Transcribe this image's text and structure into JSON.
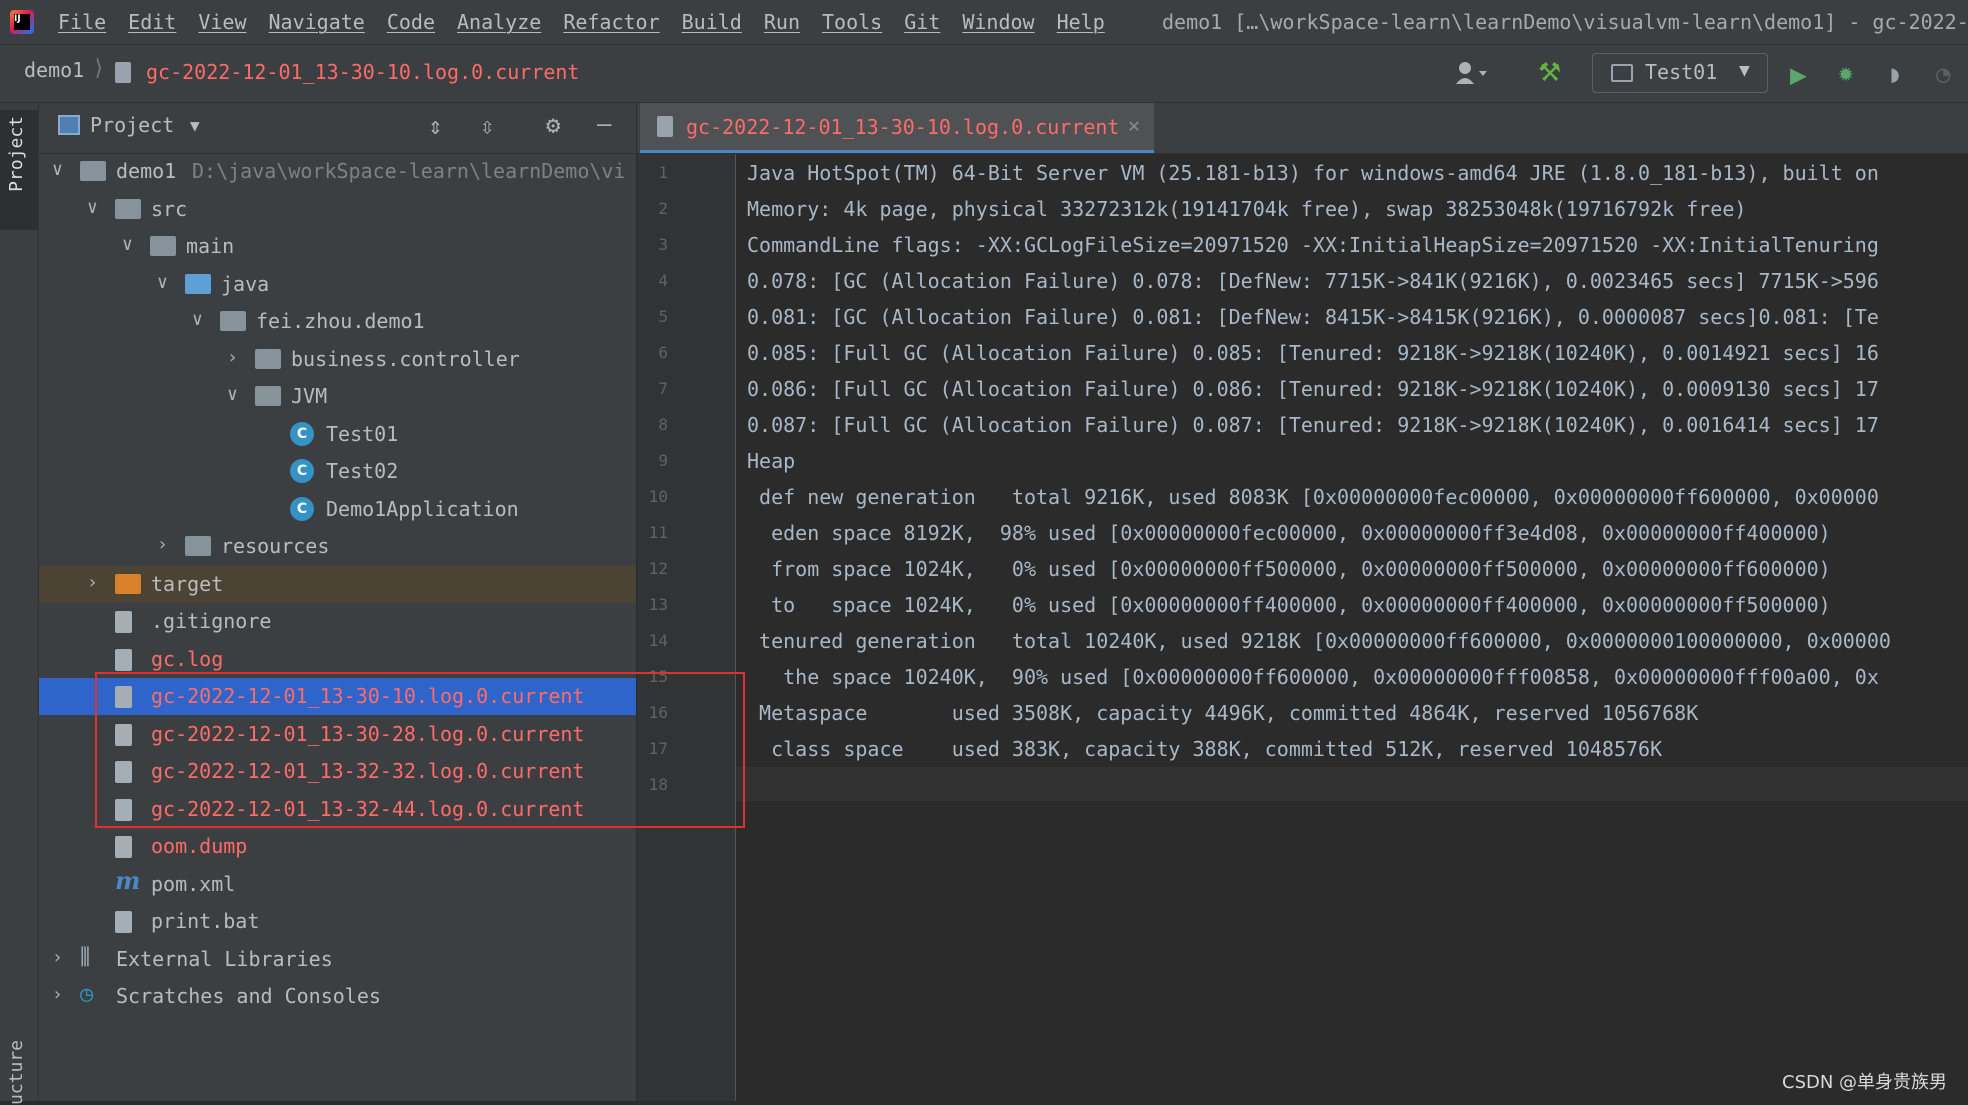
{
  "menubar": {
    "logo": "IJ",
    "items": [
      "File",
      "Edit",
      "View",
      "Navigate",
      "Code",
      "Analyze",
      "Refactor",
      "Build",
      "Run",
      "Tools",
      "Git",
      "Window",
      "Help"
    ],
    "window_title": "demo1 […\\workSpace-learn\\learnDemo\\visualvm-learn\\demo1] - gc-2022-"
  },
  "navbar": {
    "root": "demo1",
    "separator": "⟩",
    "file": "gc-2022-12-01_13-30-10.log.0.current",
    "run_config": "Test01"
  },
  "left_stripe": {
    "project": "Project",
    "structure": "ucture"
  },
  "project_panel": {
    "title": "Project",
    "tree": [
      {
        "label": "demo1",
        "path": "D:\\java\\workSpace-learn\\learnDemo\\vi",
        "icon": "module-folder-icon",
        "arrow": "∨",
        "color": "#bbbbbb"
      },
      {
        "label": "src",
        "icon": "folder-icon",
        "arrow": "∨",
        "color": "#bbbbbb"
      },
      {
        "label": "main",
        "icon": "folder-icon",
        "arrow": "∨",
        "color": "#bbbbbb"
      },
      {
        "label": "java",
        "icon": "source-folder-icon",
        "arrow": "∨",
        "color": "#bbbbbb"
      },
      {
        "label": "fei.zhou.demo1",
        "icon": "package-icon",
        "arrow": "∨",
        "color": "#bbbbbb"
      },
      {
        "label": "business.controller",
        "icon": "package-icon",
        "arrow": "›",
        "color": "#bbbbbb"
      },
      {
        "label": "JVM",
        "icon": "package-icon",
        "arrow": "∨",
        "color": "#bbbbbb"
      },
      {
        "label": "Test01",
        "icon": "java-class-icon",
        "arrow": "",
        "color": "#bbbbbb"
      },
      {
        "label": "Test02",
        "icon": "java-class-icon",
        "arrow": "",
        "color": "#bbbbbb"
      },
      {
        "label": "Demo1Application",
        "icon": "spring-boot-class-icon",
        "arrow": "",
        "color": "#bbbbbb"
      },
      {
        "label": "resources",
        "icon": "resources-folder-icon",
        "arrow": "›",
        "color": "#bbbbbb"
      },
      {
        "label": "target",
        "icon": "excluded-folder-icon",
        "arrow": "›",
        "color": "#bbbbbb"
      },
      {
        "label": ".gitignore",
        "icon": "gitignore-file-icon",
        "arrow": "",
        "color": "#bbbbbb"
      },
      {
        "label": "gc.log",
        "icon": "text-file-icon",
        "arrow": "",
        "color": "#ff6b68"
      },
      {
        "label": "gc-2022-12-01_13-30-10.log.0.current",
        "icon": "text-file-icon",
        "arrow": "",
        "color": "#ff6b68"
      },
      {
        "label": "gc-2022-12-01_13-30-28.log.0.current",
        "icon": "text-file-icon",
        "arrow": "",
        "color": "#ff6b68"
      },
      {
        "label": "gc-2022-12-01_13-32-32.log.0.current",
        "icon": "text-file-icon",
        "arrow": "",
        "color": "#ff6b68"
      },
      {
        "label": "gc-2022-12-01_13-32-44.log.0.current",
        "icon": "text-file-icon",
        "arrow": "",
        "color": "#ff6b68"
      },
      {
        "label": "oom.dump",
        "icon": "unknown-file-icon",
        "arrow": "",
        "color": "#ff6b68"
      },
      {
        "label": "pom.xml",
        "icon": "maven-icon",
        "arrow": "",
        "color": "#bbbbbb"
      },
      {
        "label": "print.bat",
        "icon": "text-file-icon",
        "arrow": "",
        "color": "#bbbbbb"
      },
      {
        "label": "External Libraries",
        "icon": "libraries-icon",
        "arrow": "›",
        "color": "#bbbbbb"
      },
      {
        "label": "Scratches and Consoles",
        "icon": "scratches-icon",
        "arrow": "›",
        "color": "#bbbbbb"
      }
    ]
  },
  "editor": {
    "tab_label": "gc-2022-12-01_13-30-10.log.0.current",
    "lines": [
      "Java HotSpot(TM) 64-Bit Server VM (25.181-b13) for windows-amd64 JRE (1.8.0_181-b13), built on",
      "Memory: 4k page, physical 33272312k(19141704k free), swap 38253048k(19716792k free)",
      "CommandLine flags: -XX:GCLogFileSize=20971520 -XX:InitialHeapSize=20971520 -XX:InitialTenuring",
      "0.078: [GC (Allocation Failure) 0.078: [DefNew: 7715K->841K(9216K), 0.0023465 secs] 7715K->596",
      "0.081: [GC (Allocation Failure) 0.081: [DefNew: 8415K->8415K(9216K), 0.0000087 secs]0.081: [Te",
      "0.085: [Full GC (Allocation Failure) 0.085: [Tenured: 9218K->9218K(10240K), 0.0014921 secs] 16",
      "0.086: [Full GC (Allocation Failure) 0.086: [Tenured: 9218K->9218K(10240K), 0.0009130 secs] 17",
      "0.087: [Full GC (Allocation Failure) 0.087: [Tenured: 9218K->9218K(10240K), 0.0016414 secs] 17",
      "Heap",
      " def new generation   total 9216K, used 8083K [0x00000000fec00000, 0x00000000ff600000, 0x00000",
      "  eden space 8192K,  98% used [0x00000000fec00000, 0x00000000ff3e4d08, 0x00000000ff400000)",
      "  from space 1024K,   0% used [0x00000000ff500000, 0x00000000ff500000, 0x00000000ff600000)",
      "  to   space 1024K,   0% used [0x00000000ff400000, 0x00000000ff400000, 0x00000000ff500000)",
      " tenured generation   total 10240K, used 9218K [0x00000000ff600000, 0x0000000100000000, 0x00000",
      "   the space 10240K,  90% used [0x00000000ff600000, 0x00000000fff00858, 0x00000000fff00a00, 0x",
      " Metaspace       used 3508K, capacity 4496K, committed 4864K, reserved 1056768K",
      "  class space    used 383K, capacity 388K, committed 512K, reserved 1048576K",
      ""
    ],
    "line_numbers": [
      "1",
      "2",
      "3",
      "4",
      "5",
      "6",
      "7",
      "8",
      "9",
      "10",
      "11",
      "12",
      "13",
      "14",
      "15",
      "16",
      "17",
      "18"
    ]
  },
  "watermark": "CSDN @单身贵族男",
  "colors": {
    "selection": "#2f65ca",
    "excluded_row": "#4b4434",
    "vcs_red": "#ff6b68",
    "highlight_box": "#e03030"
  }
}
